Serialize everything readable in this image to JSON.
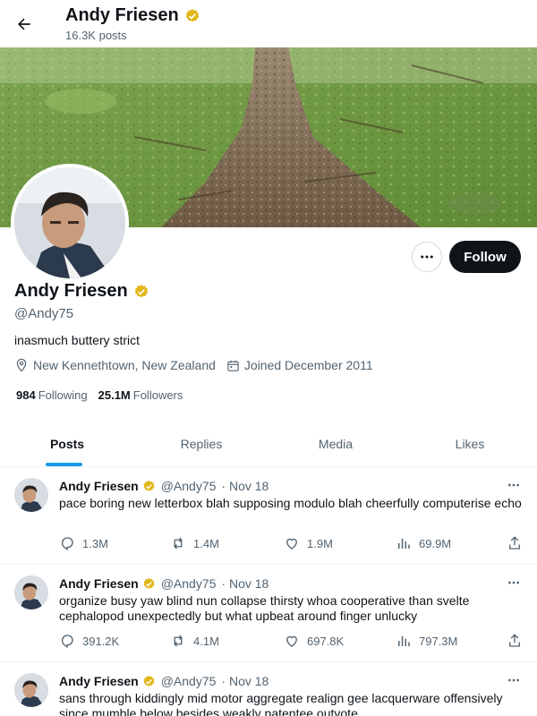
{
  "header": {
    "name": "Andy Friesen",
    "posts_count": "16.3K posts"
  },
  "profile": {
    "name": "Andy Friesen",
    "handle": "@Andy75",
    "bio": "inasmuch buttery strict",
    "location": "New Kennethtown, New Zealand",
    "joined": "Joined December 2011",
    "following_count": "984",
    "following_label": "Following",
    "followers_count": "25.1M",
    "followers_label": "Followers",
    "follow_button": "Follow"
  },
  "tabs": [
    {
      "label": "Posts",
      "active": true
    },
    {
      "label": "Replies",
      "active": false
    },
    {
      "label": "Media",
      "active": false
    },
    {
      "label": "Likes",
      "active": false
    }
  ],
  "posts": [
    {
      "name": "Andy Friesen",
      "handle": "@Andy75",
      "date": "· Nov 18",
      "text": "pace boring new letterbox blah supposing modulo blah cheerfully computerise echo",
      "replies": "1.3M",
      "reposts": "1.4M",
      "likes": "1.9M",
      "views": "69.9M"
    },
    {
      "name": "Andy Friesen",
      "handle": "@Andy75",
      "date": "· Nov 18",
      "text": "organize busy yaw blind nun collapse thirsty whoa cooperative than svelte cephalopod unexpectedly but what upbeat around finger unlucky",
      "replies": "391.2K",
      "reposts": "4.1M",
      "likes": "697.8K",
      "views": "797.3M"
    },
    {
      "name": "Andy Friesen",
      "handle": "@Andy75",
      "date": "· Nov 18",
      "text": "sans through kiddingly mid motor aggregate realign gee lacquerware offensively since mumble below besides weakly patentee outvote",
      "replies": "",
      "reposts": "",
      "likes": "",
      "views": ""
    }
  ],
  "colors": {
    "accent": "#1d9bf0",
    "verified_badge": "#e2b719",
    "text_primary": "#0f1419",
    "text_secondary": "#536471"
  }
}
